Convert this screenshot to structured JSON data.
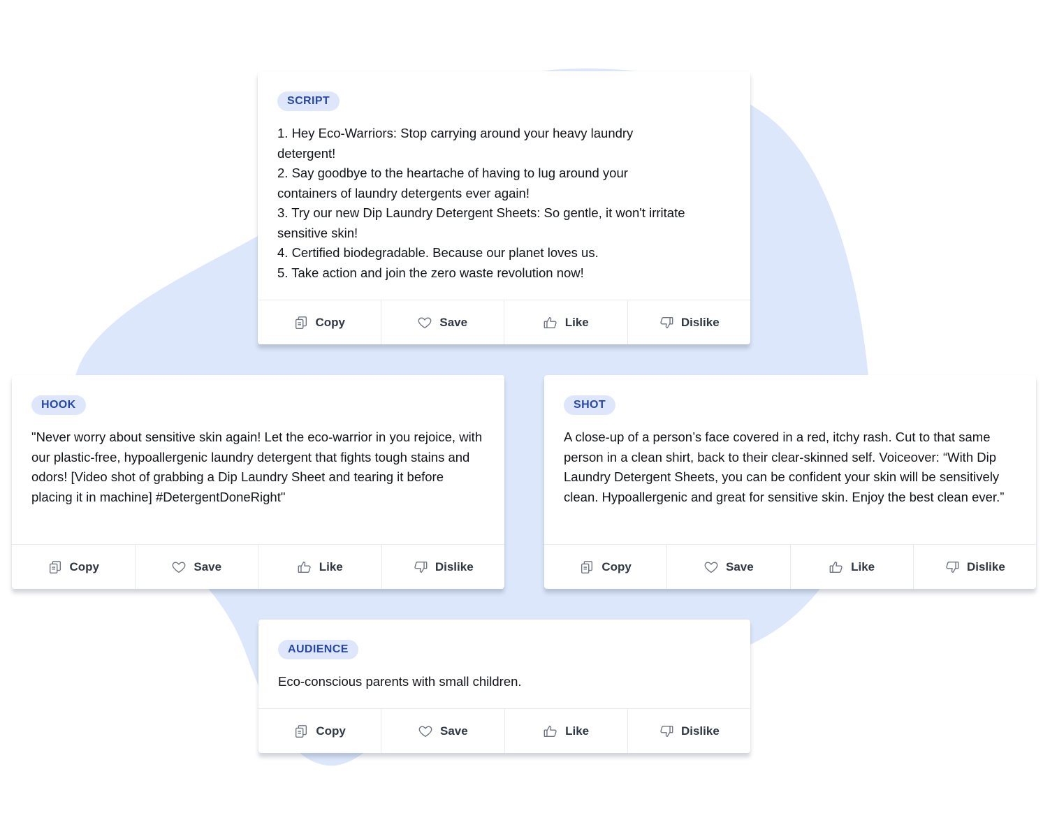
{
  "colors": {
    "blob": "#dce7fb",
    "pill_bg": "#dde6fb",
    "pill_text": "#2547a8"
  },
  "actions": {
    "copy": "Copy",
    "save": "Save",
    "like": "Like",
    "dislike": "Dislike"
  },
  "cards": {
    "script": {
      "tag": "SCRIPT",
      "text": "1. Hey Eco-Warriors: Stop carrying around your heavy laundry detergent!\n2. Say goodbye to the heartache of having to lug around your containers of laundry detergents ever again!\n3. Try our new Dip Laundry Detergent Sheets: So gentle, it won't irritate sensitive skin!\n4. Certified biodegradable. Because our planet loves us.\n5. Take action and join the zero waste revolution now!"
    },
    "hook": {
      "tag": "HOOK",
      "text": "\"Never worry about sensitive skin again! Let the eco-warrior in you rejoice, with our plastic-free, hypoallergenic laundry detergent that fights tough stains and odors! [Video shot of grabbing a Dip Laundry Sheet and tearing it before placing it in machine] #DetergentDoneRight\""
    },
    "shot": {
      "tag": "SHOT",
      "text": "A close-up of a person’s face covered in a red, itchy rash. Cut to that same person in a clean shirt, back to their clear-skinned self. Voiceover: “With Dip Laundry Detergent Sheets, you can be confident your skin will be sensitively clean. Hypoallergenic and great for sensitive skin. Enjoy the best clean ever.”"
    },
    "audience": {
      "tag": "AUDIENCE",
      "text": "Eco-conscious parents with small children."
    }
  }
}
